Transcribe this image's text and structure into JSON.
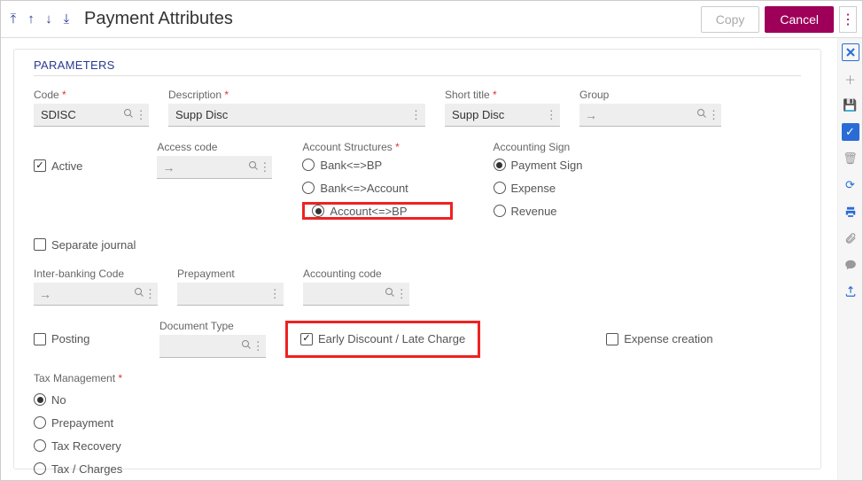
{
  "header": {
    "title": "Payment Attributes",
    "copy": "Copy",
    "cancel": "Cancel"
  },
  "section": {
    "parameters": "PARAMETERS"
  },
  "fields": {
    "code_label": "Code",
    "code_value": "SDISC",
    "desc_label": "Description",
    "desc_value": "Supp Disc",
    "short_label": "Short title",
    "short_value": "Supp Disc",
    "group_label": "Group",
    "group_value": "",
    "active_label": "Active",
    "access_label": "Access code",
    "access_value": "",
    "struct_label": "Account Structures",
    "struct_opts": [
      "Bank<=>BP",
      "Bank<=>Account",
      "Account<=>BP"
    ],
    "sign_label": "Accounting Sign",
    "sign_opts": [
      "Payment Sign",
      "Expense",
      "Revenue"
    ],
    "sep_journal": "Separate journal",
    "ib_label": "Inter-banking Code",
    "ib_value": "",
    "prep_label": "Prepayment",
    "prep_value": "",
    "acc_label": "Accounting code",
    "acc_value": "",
    "posting": "Posting",
    "doctype_label": "Document Type",
    "doctype_value": "",
    "early_disc": "Early Discount / Late Charge",
    "exp_creation": "Expense creation",
    "tax_label": "Tax Management",
    "tax_opts": [
      "No",
      "Prepayment",
      "Tax Recovery",
      "Tax / Charges"
    ]
  },
  "state": {
    "active_checked": true,
    "sep_journal_checked": false,
    "struct_selected": 2,
    "sign_selected": 0,
    "posting_checked": false,
    "early_disc_checked": true,
    "exp_creation_checked": false,
    "tax_selected": 0
  }
}
